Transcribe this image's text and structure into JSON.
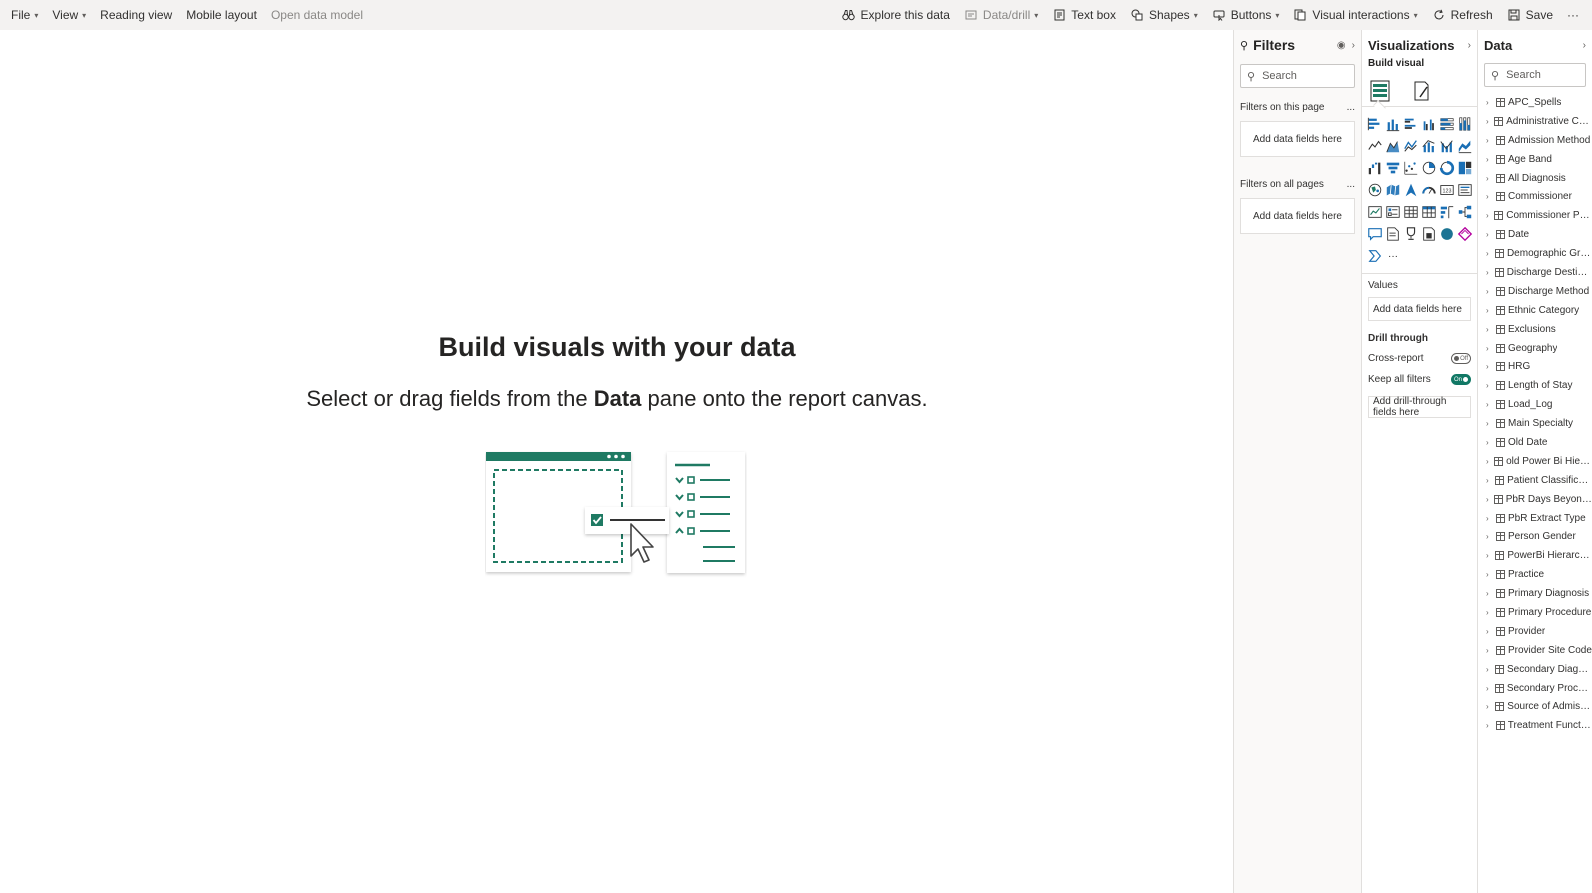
{
  "toolbar": {
    "left": [
      {
        "label": "File",
        "chevron": true
      },
      {
        "label": "View",
        "chevron": true
      },
      {
        "label": "Reading view",
        "chevron": false
      },
      {
        "label": "Mobile layout",
        "chevron": false
      },
      {
        "label": "Open data model",
        "chevron": false,
        "dim": true
      }
    ],
    "explore": "Explore this data",
    "datadrill": "Data/drill",
    "textbox": "Text box",
    "shapes": "Shapes",
    "buttons": "Buttons",
    "visual_interactions": "Visual interactions",
    "refresh": "Refresh",
    "save": "Save",
    "more": "···"
  },
  "canvas": {
    "title": "Build visuals with your data",
    "subtitle_pre": "Select or drag fields from the ",
    "subtitle_bold": "Data",
    "subtitle_post": " pane onto the report canvas."
  },
  "filters": {
    "title": "Filters",
    "search_placeholder": "Search",
    "on_this_page": "Filters on this page",
    "on_all_pages": "Filters on all pages",
    "more": "...",
    "add_fields": "Add data fields here"
  },
  "visualizations": {
    "title": "Visualizations",
    "build_visual": "Build visual",
    "values_label": "Values",
    "values_placeholder": "Add data fields here",
    "drill_through": "Drill through",
    "cross_report": "Cross-report",
    "cross_report_state": "Off",
    "keep_all_filters": "Keep all filters",
    "keep_all_filters_state": "On",
    "drill_placeholder": "Add drill-through fields here",
    "more_visuals": "···"
  },
  "data": {
    "title": "Data",
    "search_placeholder": "Search",
    "tables": [
      "APC_Spells",
      "Administrative Category",
      "Admission Method",
      "Age Band",
      "All Diagnosis",
      "Commissioner",
      "Commissioner Provider",
      "Date",
      "Demographic Groups",
      "Discharge Destination",
      "Discharge Method",
      "Ethnic Category",
      "Exclusions",
      "Geography",
      "HRG",
      "Length of Stay",
      "Load_Log",
      "Main Specialty",
      "Old Date",
      "old Power Bi Hierachies",
      "Patient Classification",
      "PbR Days Beyond Trim...",
      "PbR Extract Type",
      "Person Gender",
      "PowerBi Hierarchies",
      "Practice",
      "Primary Diagnosis",
      "Primary Procedure",
      "Provider",
      "Provider Site Code",
      "Secondary Diagnosis",
      "Secondary Procedure",
      "Source of Admission",
      "Treatment Function"
    ]
  },
  "colors": {
    "accent": "#117865",
    "viz_blue": "#1a6fb5"
  }
}
